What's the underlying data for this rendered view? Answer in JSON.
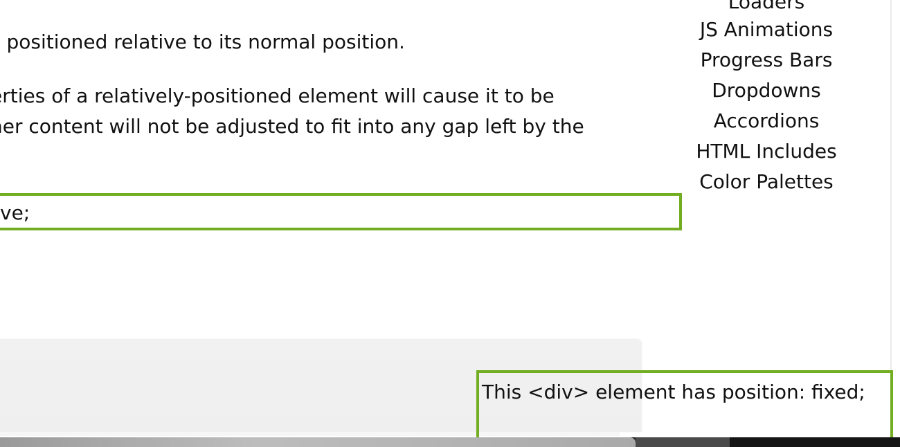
{
  "main": {
    "paragraph1": "s positioned relative to its normal position.",
    "paragraph2_line1": "erties of a relatively-positioned element will cause it to be",
    "paragraph2_line2": "her content will not be adjusted to fit into any gap left by the",
    "relative_box_text": "ve;"
  },
  "sidebar": {
    "items": [
      {
        "label": "Loaders"
      },
      {
        "label": "JS Animations"
      },
      {
        "label": "Progress Bars"
      },
      {
        "label": "Dropdowns"
      },
      {
        "label": "Accordions"
      },
      {
        "label": "HTML Includes"
      },
      {
        "label": "Color Palettes"
      }
    ]
  },
  "fixed_box": {
    "text": "This <div> element has position: fixed;"
  },
  "colors": {
    "accent_border": "#73AD21",
    "panel_background": "#f1f1f1"
  }
}
